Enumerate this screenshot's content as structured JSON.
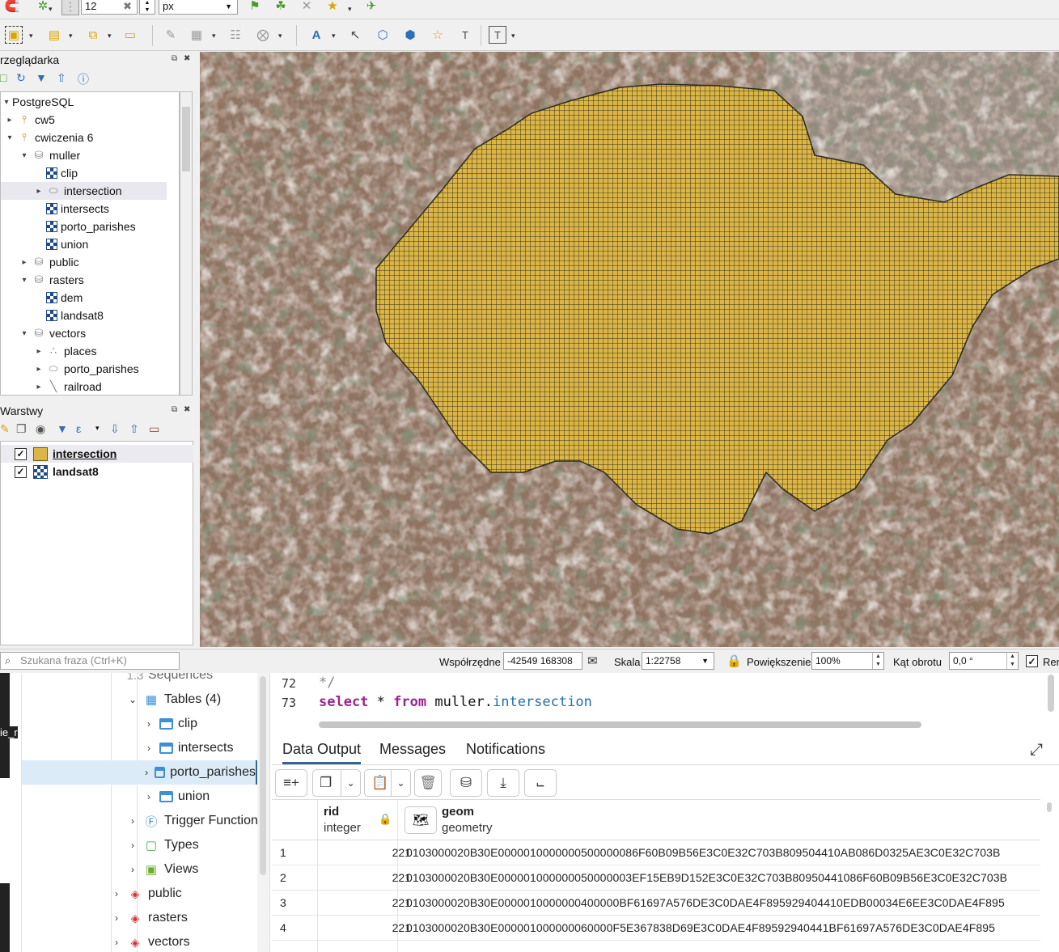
{
  "toolbar_top": {
    "font_size_value": "12",
    "unit_value": "px"
  },
  "browser": {
    "title": "Przeglądarka",
    "title_visible": "rzeglądarka",
    "nodes": [
      {
        "label": "PostgreSQL",
        "icon": "postgresql-icon"
      },
      {
        "label": "cw5",
        "icon": "connection-icon"
      },
      {
        "label": "cwiczenia 6",
        "icon": "connection-icon"
      },
      {
        "label": "muller",
        "icon": "schema-icon"
      },
      {
        "label": "clip",
        "icon": "raster-icon"
      },
      {
        "label": "intersection",
        "icon": "polygon-icon"
      },
      {
        "label": "intersects",
        "icon": "raster-icon"
      },
      {
        "label": "porto_parishes",
        "icon": "raster-icon"
      },
      {
        "label": "union",
        "icon": "raster-icon"
      },
      {
        "label": "public",
        "icon": "schema-icon"
      },
      {
        "label": "rasters",
        "icon": "schema-icon"
      },
      {
        "label": "dem",
        "icon": "raster-icon"
      },
      {
        "label": "landsat8",
        "icon": "raster-icon"
      },
      {
        "label": "vectors",
        "icon": "schema-icon"
      },
      {
        "label": "places",
        "icon": "point-icon"
      },
      {
        "label": "porto_parishes",
        "icon": "polygon-icon"
      },
      {
        "label": "railroad",
        "icon": "line-icon"
      }
    ]
  },
  "layers": {
    "title_visible": "Warstwy",
    "items": [
      {
        "label": "intersection",
        "checked": true,
        "symbol": "polygon",
        "color": "#dbb646"
      },
      {
        "label": "landsat8",
        "checked": true,
        "symbol": "raster"
      }
    ]
  },
  "statusbar": {
    "search_placeholder": "Szukana fraza (Ctrl+K)",
    "coords_label": "Współrzędne",
    "coords_value": "-42549 168308",
    "scale_label": "Skala",
    "scale_value": "1:22758",
    "zoom_label": "Powiększenie",
    "zoom_value": "100%",
    "rotation_label": "Kąt obrotu",
    "rotation_value": "0,0 °",
    "render_label": "Ren"
  },
  "pgadmin": {
    "left_edge_text": "ie_r",
    "tree": [
      {
        "label": "Sequences",
        "icon": "sequence-icon"
      },
      {
        "label": "Tables (4)",
        "icon": "tables-icon"
      },
      {
        "label": "clip",
        "icon": "table-icon"
      },
      {
        "label": "intersects",
        "icon": "table-icon"
      },
      {
        "label": "porto_parishes",
        "icon": "table-icon"
      },
      {
        "label": "union",
        "icon": "table-icon"
      },
      {
        "label": "Trigger Functions",
        "icon": "trigger-function-icon"
      },
      {
        "label": "Types",
        "icon": "types-icon"
      },
      {
        "label": "Views",
        "icon": "views-icon"
      },
      {
        "label": "public",
        "icon": "schema-icon"
      },
      {
        "label": "rasters",
        "icon": "schema-icon"
      },
      {
        "label": "vectors",
        "icon": "schema-icon"
      }
    ],
    "editor": {
      "line1_no": "72",
      "line1_text": "*/",
      "line2_no": "73",
      "line2_kw1": "select",
      "line2_star": " * ",
      "line2_kw2": "from",
      "line2_schema": " muller.",
      "line2_table": "intersection"
    },
    "tabs": [
      "Data Output",
      "Messages",
      "Notifications"
    ],
    "columns": [
      {
        "name": "rid",
        "type": "integer"
      },
      {
        "name": "geom",
        "type": "geometry"
      }
    ],
    "rows": [
      {
        "n": "1",
        "rid": "221",
        "geom": "0103000020B30E0000010000000500000086F60B09B56E3C0E32C703B809504410AB086D0325AE3C0E32C703B"
      },
      {
        "n": "2",
        "rid": "221",
        "geom": "0103000020B30E000001000000050000003EF15EB9D152E3C0E32C703B80950441086F60B09B56E3C0E32C703B"
      },
      {
        "n": "3",
        "rid": "221",
        "geom": "0103000020B30E0000010000000400000BF61697A576DE3C0DAE4F895929404410EDB00034E6EE3C0DAE4F895"
      },
      {
        "n": "4",
        "rid": "221",
        "geom": "0103000020B30E000001000000060000F5E367838D69E3C0DAE4F89592940441BF61697A576DE3C0DAE4F895"
      }
    ]
  },
  "colors": {
    "polygon_fill": "#dbb646",
    "polygon_stroke": "#2a2a1a",
    "pg_accent": "#326690",
    "keyword": "#9b2393"
  }
}
